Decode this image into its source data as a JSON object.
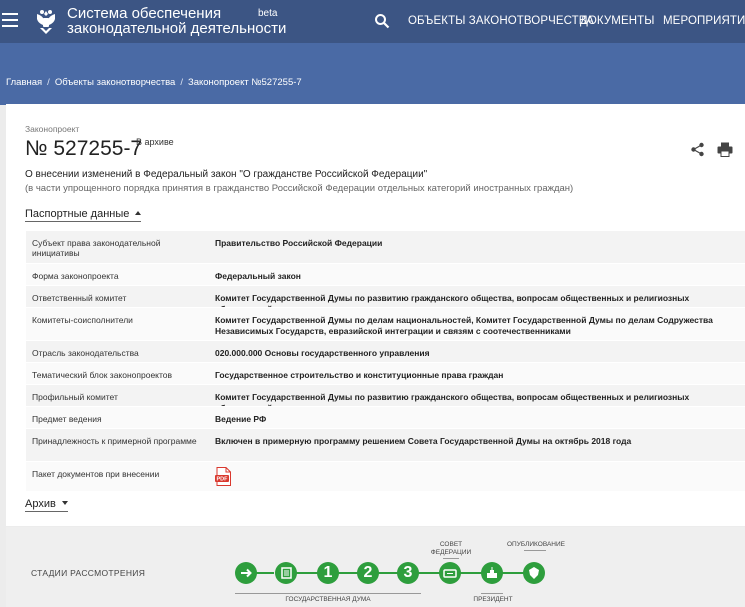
{
  "header": {
    "brand_line1": "Система обеспечения",
    "brand_line2": "законодательной деятельности",
    "beta": "beta",
    "nav": [
      "ОБЪЕКТЫ ЗАКОНОТВОРЧЕСТВА",
      "ДОКУМЕНТЫ",
      "МЕРОПРИЯТИЯ"
    ]
  },
  "breadcrumb": [
    "Главная",
    "Объекты законотворчества",
    "Законопроект №527255-7"
  ],
  "bill": {
    "kicker": "Законопроект",
    "number": "№ 527255-7",
    "status": "В архиве",
    "title": "О внесении изменений в Федеральный закон \"О гражданстве Российской Федерации\"",
    "subtitle": "(в части упрощенного порядка принятия в гражданство Российской Федерации отдельных категорий иностранных граждан)"
  },
  "passport": {
    "heading": "Паспортные данные",
    "rows": [
      {
        "label": "Субъект права законодательной инициативы",
        "value": "Правительство Российской Федерации"
      },
      {
        "label": "Форма законопроекта",
        "value": "Федеральный закон"
      },
      {
        "label": "Ответственный комитет",
        "value": "Комитет Государственной Думы по развитию гражданского общества, вопросам общественных и религиозных объединений"
      },
      {
        "label": "Комитеты-соисполнители",
        "value": "Комитет Государственной Думы по делам национальностей, Комитет Государственной Думы по делам Содружества Независимых Государств, евразийской интеграции и связям с соотечественниками"
      },
      {
        "label": "Отрасль законодательства",
        "value": "020.000.000 Основы государственного управления"
      },
      {
        "label": "Тематический блок законопроектов",
        "value": "Государственное строительство и конституционные права граждан"
      },
      {
        "label": "Профильный комитет",
        "value": "Комитет Государственной Думы по развитию гражданского общества, вопросам общественных и религиозных объединений"
      },
      {
        "label": "Предмет ведения",
        "value": "Ведение РФ"
      },
      {
        "label": "Принадлежность к примерной программе",
        "value": "Включен в примерную программу решением Совета Государственной Думы на октябрь 2018 года"
      },
      {
        "label": "Пакет документов при внесении",
        "value": ""
      }
    ],
    "pdf_icon": "pdf-icon"
  },
  "archive": {
    "heading": "Архив"
  },
  "stages": {
    "title": "СТАДИИ РАССМОТРЕНИЯ",
    "numbers": [
      "1",
      "2",
      "3"
    ],
    "labels": {
      "duma": "ГОСУДАРСТВЕННАЯ ДУМА",
      "council_line1": "СОВЕТ",
      "council_line2": "ФЕДЕРАЦИИ",
      "president": "ПРЕЗИДЕНТ",
      "publication": "ОПУБЛИКОВАНИЕ"
    },
    "accent": "#2e9e3d"
  },
  "colors": {
    "header": "#3c5584",
    "band": "#4a6aa5",
    "pdf": "#d9382e"
  }
}
